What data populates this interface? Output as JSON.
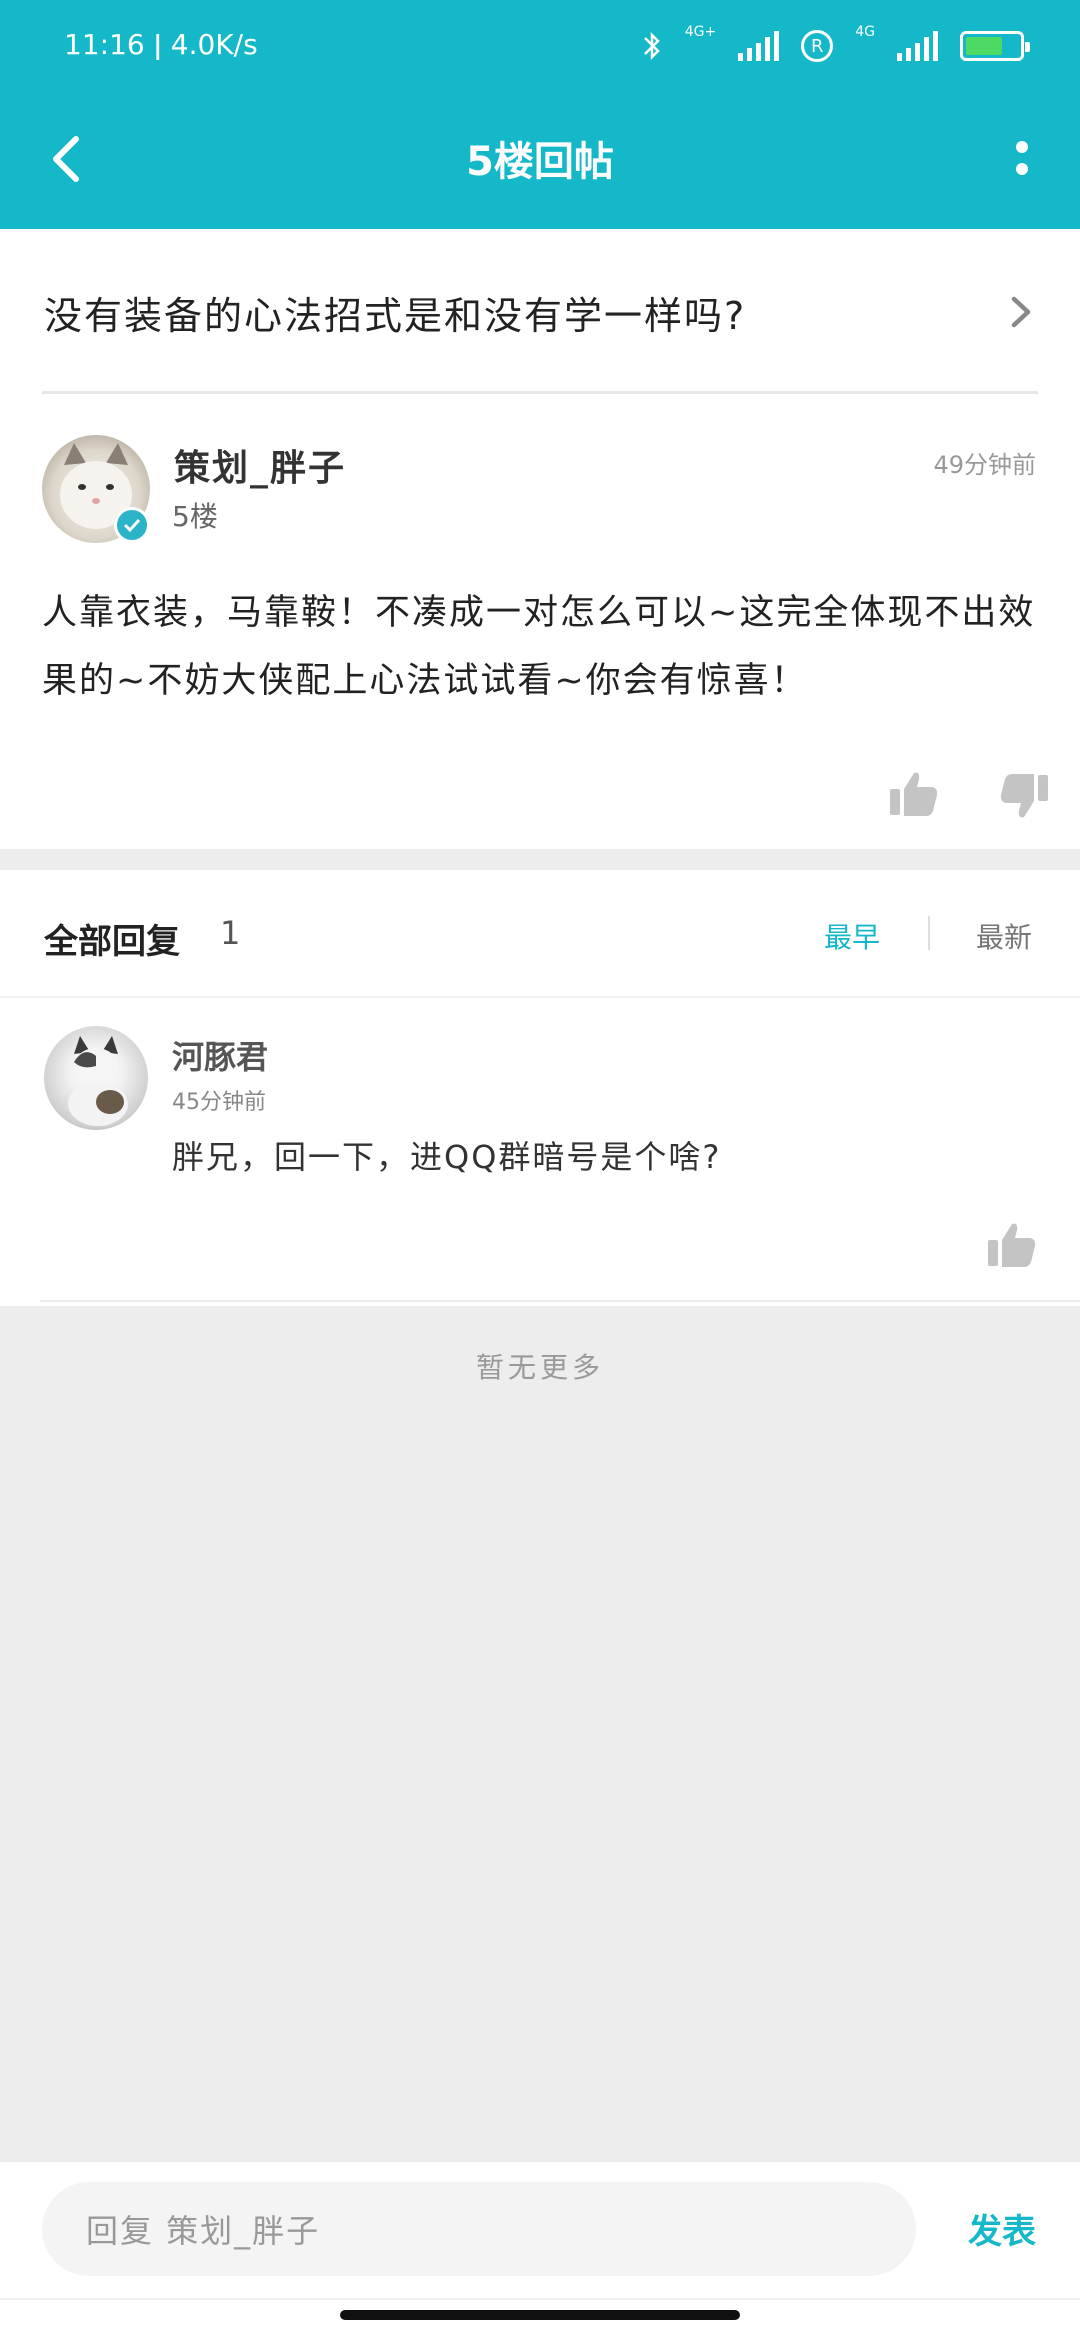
{
  "status_bar": {
    "time": "11:16",
    "speed": "4.0K/s",
    "net1": "4G+",
    "net2": "4G",
    "roaming": "R",
    "battery_level": 0.7
  },
  "nav": {
    "title": "5楼回帖"
  },
  "topic": {
    "title": "没有装备的心法招式是和没有学一样吗?"
  },
  "post": {
    "author": "策划_胖子",
    "floor": "5楼",
    "time": "49分钟前",
    "content": "人靠衣装，马靠鞍！不凑成一对怎么可以~这完全体现不出效果的~不妨大侠配上心法试试看~你会有惊喜！"
  },
  "replies_header": {
    "title": "全部回复",
    "count": "1",
    "sort_earliest": "最早",
    "sort_newest": "最新"
  },
  "replies": [
    {
      "author": "河豚君",
      "time": "45分钟前",
      "content": "胖兄，回一下，进QQ群暗号是个啥?"
    }
  ],
  "footer_note": "暂无更多",
  "composer": {
    "placeholder": "回复 策划_胖子",
    "send_label": "发表"
  },
  "colors": {
    "accent": "#14b8c8",
    "background": "#ededed"
  }
}
